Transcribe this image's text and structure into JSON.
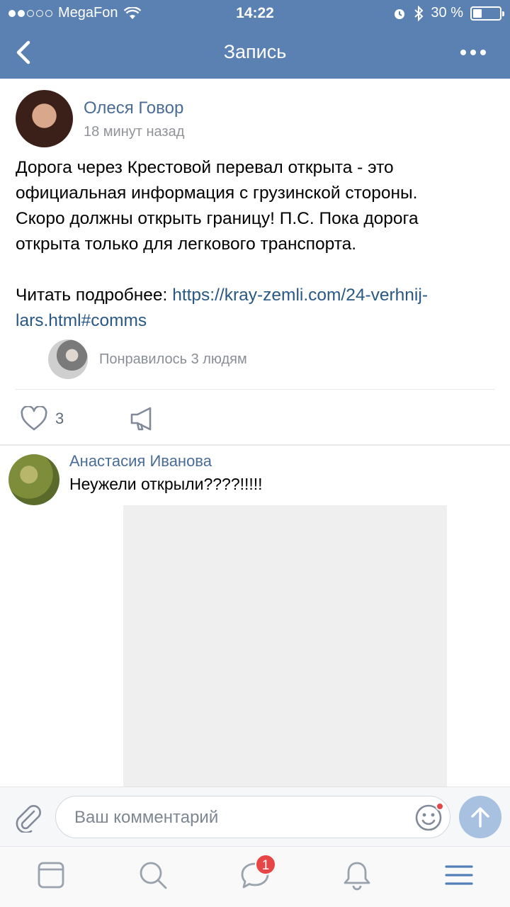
{
  "status_bar": {
    "carrier": "MegaFon",
    "time": "14:22",
    "battery_percent": "30 %",
    "battery_level": 0.3
  },
  "nav": {
    "title": "Запись",
    "back_icon": "chevron-left-icon",
    "more_icon": "more-dots-icon"
  },
  "post": {
    "author": "Олеся Говор",
    "time": "18 минут назад",
    "text_line1": "Дорога через Крестовой перевал открыта - это",
    "text_line2": "официальная информация с грузинской стороны.",
    "text_line3": "Скоро должны открыть границу! П.С. Пока дорога",
    "text_line4": "открыта только для легкового транспорта.",
    "read_more_label": "Читать подробнее:",
    "link_line1": "https://kray-zemli.com/24-verhnij-",
    "link_line2": "lars.html#comms",
    "likes_text": "Понравилось 3 людям",
    "like_count": "3"
  },
  "comment": {
    "author": "Анастасия Иванова",
    "text": "Неужели открыли????!!!!!"
  },
  "input": {
    "placeholder": "Ваш комментарий"
  },
  "tabs": {
    "messages_badge": "1"
  },
  "colors": {
    "header": "#5b80b2",
    "link": "#2a5885",
    "name": "#4a6c95",
    "badge": "#e64646",
    "send": "#a9c1e0"
  }
}
